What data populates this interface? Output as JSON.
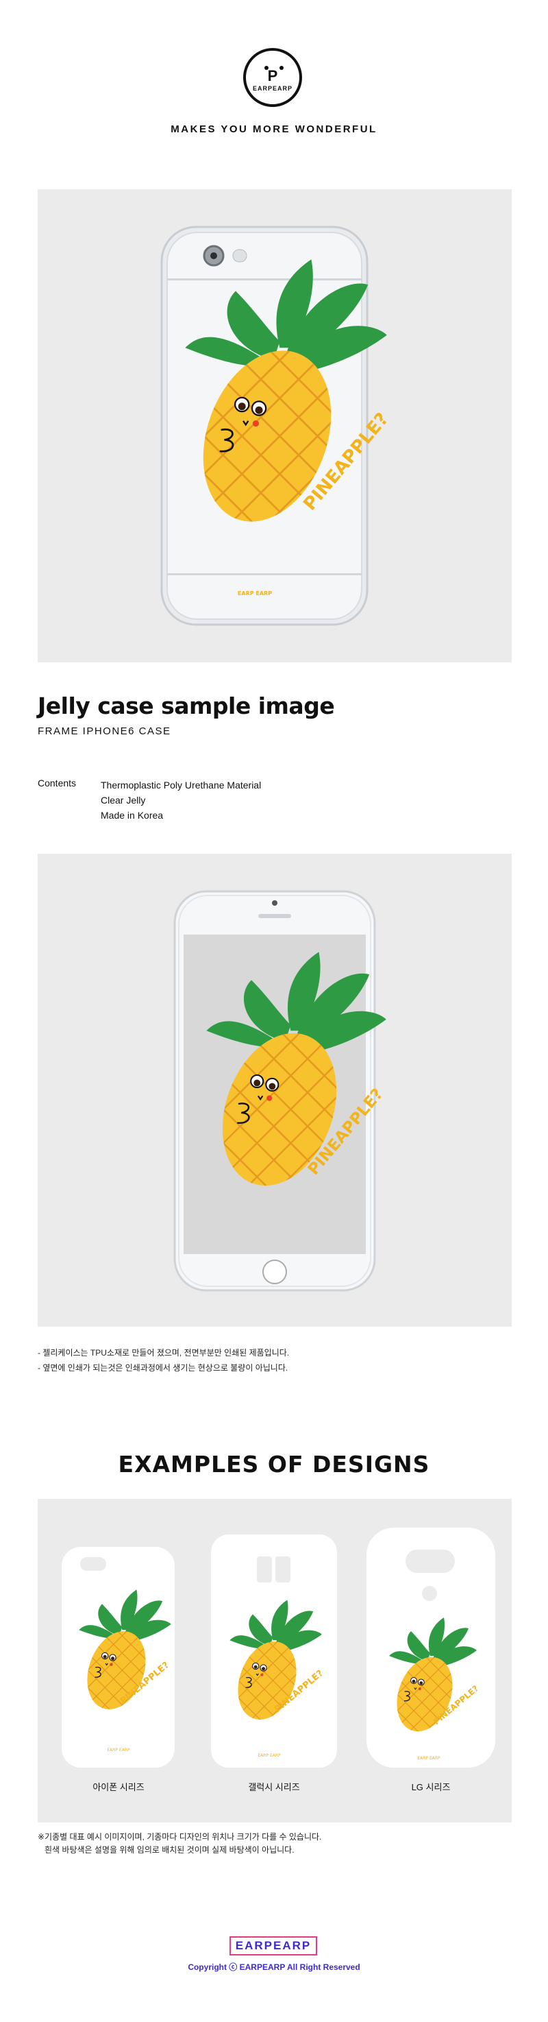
{
  "brand": {
    "logo_letter": "P",
    "logo_text": "EARPEARP",
    "tagline": "MAKES YOU MORE WONDERFUL"
  },
  "artwork": {
    "pineapple_text": "PINEAPPLE?",
    "case_small_text": "EARP EARP"
  },
  "product": {
    "title": "Jelly case sample image",
    "subtitle": "FRAME IPHONE6 CASE",
    "contents_label": "Contents",
    "contents": [
      "Thermoplastic Poly Urethane Material",
      "Clear Jelly",
      "Made in Korea"
    ]
  },
  "notes": [
    "- 젤리케이스는 TPU소재로 만들어 졌으며, 전면부분만 인쇄된 제품입니다.",
    "- 옆면에 인쇄가 되는것은 인쇄과정에서 생기는 현상으로 불량이 아닙니다."
  ],
  "examples": {
    "title": "EXAMPLES OF DESIGNS",
    "cards": [
      {
        "label": "아이폰 시리즈"
      },
      {
        "label": "갤럭시 시리즈"
      },
      {
        "label": "LG 시리즈"
      }
    ],
    "footnote": [
      "※기종별 대표 예시 이미지이며, 기종마다 디자인의 위치나 크기가 다를 수 있습니다.",
      "  흰색 바탕색은 설명을 위해 임의로 배치된 것이며 실제 바탕색이 아닙니다."
    ]
  },
  "footer": {
    "logo": "EARPEARP",
    "copyright": "Copyright ⓒ EARPEARP All Right Reserved"
  },
  "colors": {
    "panel": "#ebebeb",
    "pineapple_body": "#f7c22e",
    "pineapple_grid": "#e49a1e",
    "leaves": "#2e9a44",
    "text_orange": "#f2b31c",
    "footer_accent": "#3c2ad4",
    "footer_border": "#e03a8c"
  }
}
